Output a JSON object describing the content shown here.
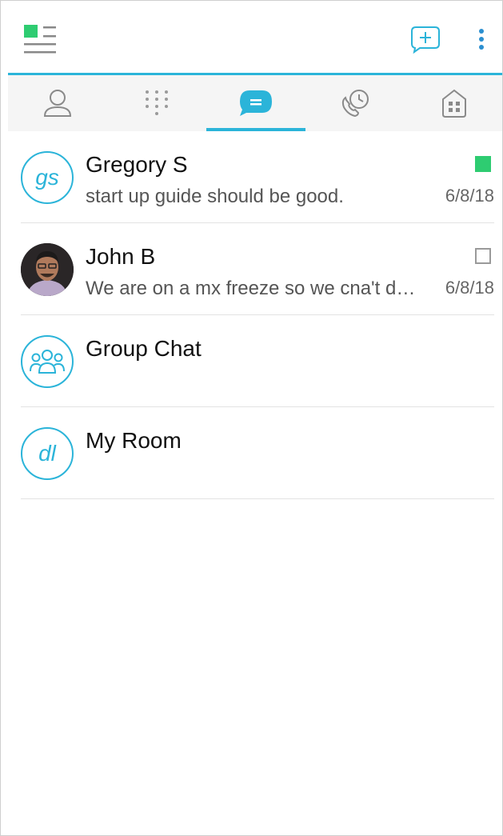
{
  "header": {
    "menu_icon": "menu-icon",
    "new_chat_icon": "add-chat-icon",
    "more_icon": "more-vertical-icon"
  },
  "tabs": [
    {
      "name": "contacts",
      "icon": "person-icon",
      "active": false
    },
    {
      "name": "dialpad",
      "icon": "dialpad-icon",
      "active": false
    },
    {
      "name": "chats",
      "icon": "chat-bubble-icon",
      "active": true
    },
    {
      "name": "recents",
      "icon": "phone-clock-icon",
      "active": false
    },
    {
      "name": "rooms",
      "icon": "building-icon",
      "active": false
    }
  ],
  "conversations": [
    {
      "name": "Gregory S",
      "initials": "gs",
      "preview": "start up guide should be good.",
      "date": "6/8/18",
      "status": "online"
    },
    {
      "name": "John B",
      "avatar": "photo",
      "preview": "We are on a mx freeze so we cna't do it till next week",
      "date": "6/8/18",
      "status": "offline"
    },
    {
      "name": "Group Chat",
      "avatar": "group-icon"
    },
    {
      "name": "My Room",
      "initials": "dl"
    }
  ],
  "colors": {
    "accent": "#2bb4d9",
    "online": "#2ecc71",
    "logo_green": "#2ecc71",
    "tab_bar_bg": "#f5f5f5"
  }
}
